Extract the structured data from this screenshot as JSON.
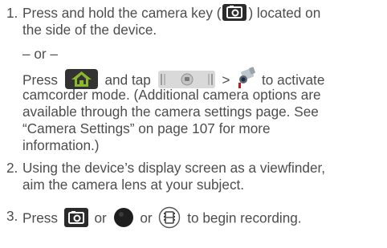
{
  "steps": [
    {
      "number": "1.",
      "line1_text": "Press and hold the camera key (",
      "line1_after": ") located on",
      "line2": "the side of the device.",
      "or_text": "– or –",
      "press_before": "Press",
      "press_mid": "and tap",
      "press_gt": ">",
      "press_after": "to activate",
      "sub_lines": [
        "camcorder mode. (Additional camera options are",
        "available through the camera settings page. See",
        "“Camera Settings” on page 107 for more",
        "information.)"
      ],
      "icons": [
        "camera-key-icon",
        "home-icon",
        "camera-selector-icon",
        "camcorder-icon"
      ]
    },
    {
      "number": "2.",
      "lines": [
        "Using the device’s display screen as a viewfinder,",
        "aim the camera lens at your subject."
      ]
    },
    {
      "number": "3.",
      "w_press": "Press",
      "w_or1": "or",
      "w_or2": "or",
      "w_end": "to begin recording.",
      "icons": [
        "camera-key-icon",
        "record-button-icon",
        "video-mode-icon"
      ]
    }
  ],
  "colors": {
    "text": "#4d4d4d",
    "icon_dark": "#2b2b2b",
    "home_arrow": "#8ab82e"
  }
}
